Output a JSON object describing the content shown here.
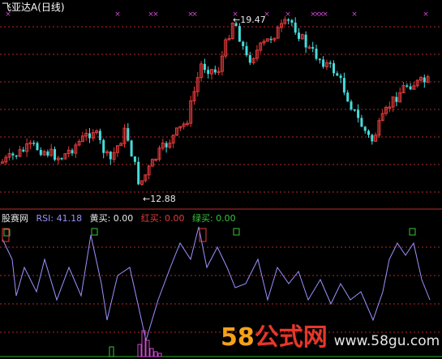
{
  "title": {
    "name": "飞亚达A",
    "period": "(日线)"
  },
  "price_chart": {
    "high_label": "19.47",
    "low_label": "12.88",
    "arrow": "←",
    "colors": {
      "up": "#e23a3a",
      "down": "#46dcdc",
      "grid": "#b52a2a",
      "marker": "#d048d0"
    }
  },
  "indicator": {
    "source": "股赛网",
    "rsi": "RSI: 41.18",
    "yellow_buy": "黄买: 0.00",
    "red_buy": "红买: 0.00",
    "green_buy": "绿买: 0.00",
    "line_color": "#9b93ff"
  },
  "watermark": {
    "part_a": "58",
    "part_b": "公式网",
    "url": "www.58gu.com"
  }
}
